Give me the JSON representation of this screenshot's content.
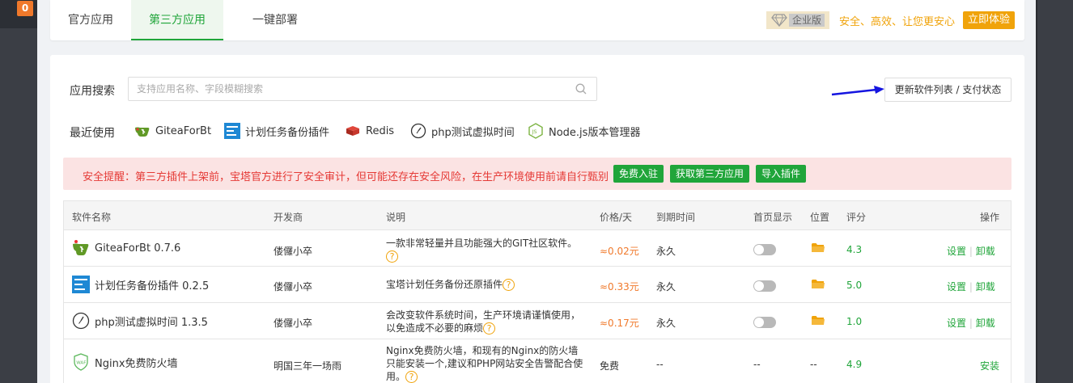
{
  "sidebar": {
    "badge_count": "0"
  },
  "tabs": [
    {
      "label": "官方应用"
    },
    {
      "label": "第三方应用"
    },
    {
      "label": "一键部署"
    }
  ],
  "enterprise": {
    "badge_label": "企业版",
    "slogan": "安全、高效、让您更安心",
    "try_button": "立即体验"
  },
  "search": {
    "label": "应用搜索",
    "placeholder": "支持应用名称、字段模糊搜索",
    "value": ""
  },
  "update_button": "更新软件列表 / 支付状态",
  "recent": {
    "label": "最近使用",
    "items": [
      {
        "label": "GiteaForBt",
        "icon": "gitea-icon"
      },
      {
        "label": "计划任务备份插件",
        "icon": "backup-icon"
      },
      {
        "label": "Redis",
        "icon": "redis-icon"
      },
      {
        "label": "php测试虚拟时间",
        "icon": "clock-icon"
      },
      {
        "label": "Node.js版本管理器",
        "icon": "nodejs-icon"
      }
    ]
  },
  "alert": {
    "text": "安全提醒：第三方插件上架前，宝塔官方进行了安全审计，但可能还存在安全风险，在生产环境使用前请自行甄别",
    "buttons": [
      "免费入驻",
      "获取第三方应用",
      "导入插件"
    ]
  },
  "table": {
    "headers": [
      "软件名称",
      "开发商",
      "说明",
      "价格/天",
      "到期时间",
      "首页显示",
      "位置",
      "评分",
      "操作"
    ],
    "rows": [
      {
        "name": "GiteaForBt 0.7.6",
        "icon": "gitea-icon",
        "developer": "偻儸小卒",
        "desc_line1": "一款非常轻量并且功能强大的GIT社区软件。",
        "desc_line2": "",
        "price": "≈0.02元",
        "expire": "永久",
        "position_icon": "folder-icon",
        "score": "4.3",
        "ops": [
          "设置",
          "卸载"
        ]
      },
      {
        "name": "计划任务备份插件 0.2.5",
        "icon": "backup-icon",
        "developer": "偻儸小卒",
        "desc_line1": "宝塔计划任务备份还原插件",
        "desc_line2": "",
        "price": "≈0.33元",
        "expire": "永久",
        "position_icon": "folder-icon",
        "score": "5.0",
        "ops": [
          "设置",
          "卸载"
        ]
      },
      {
        "name": "php测试虚拟时间 1.3.5",
        "icon": "clock-icon",
        "developer": "偻儸小卒",
        "desc_line1": "会改变软件系统时间，生产环境请谨慎使用，",
        "desc_line2": "以免造成不必要的麻烦",
        "price": "≈0.17元",
        "expire": "永久",
        "position_icon": "folder-icon",
        "score": "1.0",
        "ops": [
          "设置",
          "卸载"
        ]
      },
      {
        "name": "Nginx免费防火墙",
        "icon": "waf-icon",
        "developer": "明国三年一场雨",
        "desc_line1": "Nginx免费防火墙，和现有的Nginx的防火墙",
        "desc_line2": "只能安装一个,建议和PHP网站安全告警配合使",
        "desc_line3": "用。",
        "price": "免费",
        "expire": "--",
        "home": "--",
        "position": "--",
        "score": "4.9",
        "ops": [
          "安装"
        ]
      }
    ]
  },
  "colors": {
    "accent": "#20a53a",
    "warning": "#f0a30a",
    "price": "#f0792b",
    "alert_bg": "#fbe3e3",
    "alert_text": "#e53935"
  }
}
